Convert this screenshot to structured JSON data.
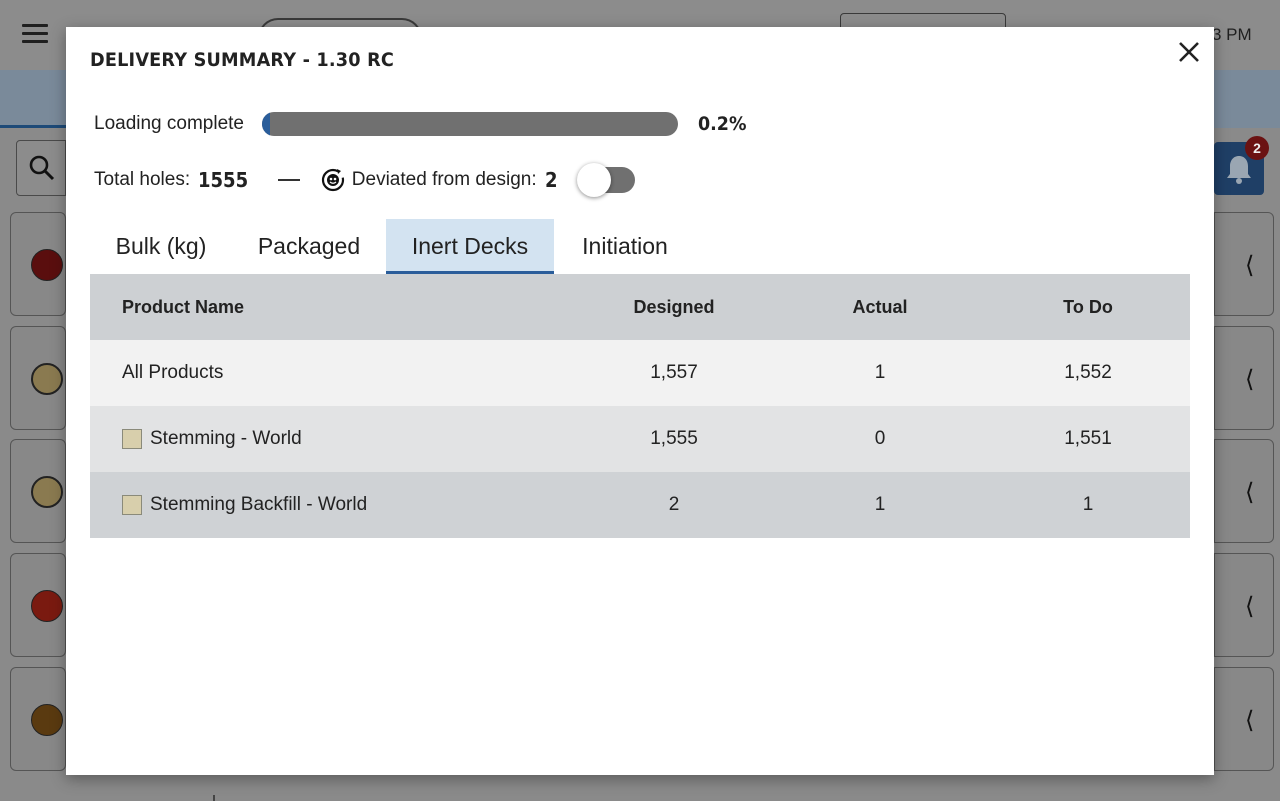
{
  "background": {
    "time_fragment": "3 PM",
    "notification_count": "2"
  },
  "modal": {
    "title": "DELIVERY SUMMARY - 1.30 RC",
    "close_icon": "close-icon",
    "loading": {
      "label": "Loading complete",
      "percent_text": "0.2%",
      "progress_fraction": 0.002
    },
    "stats": {
      "total_holes_label": "Total holes:",
      "total_holes_value": "1555",
      "deviated_label": "Deviated from design:",
      "deviated_value": "2",
      "deviated_toggle_on": false
    },
    "tabs": [
      {
        "label": "Bulk (kg)",
        "active": false
      },
      {
        "label": "Packaged",
        "active": false
      },
      {
        "label": "Inert Decks",
        "active": true
      },
      {
        "label": "Initiation",
        "active": false
      }
    ],
    "table": {
      "headers": {
        "product_name": "Product Name",
        "designed": "Designed",
        "actual": "Actual",
        "todo": "To Do"
      },
      "rows": [
        {
          "name": "All Products",
          "designed": "1,557",
          "actual": "1",
          "todo": "1,552",
          "swatch": false
        },
        {
          "name": "Stemming - World",
          "designed": "1,555",
          "actual": "0",
          "todo": "1,551",
          "swatch": true,
          "swatch_color": "#d8cfac"
        },
        {
          "name": "Stemming Backfill - World",
          "designed": "2",
          "actual": "1",
          "todo": "1",
          "swatch": true,
          "swatch_color": "#d8cfac"
        }
      ]
    }
  },
  "colors": {
    "accent": "#2a5d9a",
    "active_tab_bg": "#d3e3f1",
    "progress_track": "#707070"
  }
}
